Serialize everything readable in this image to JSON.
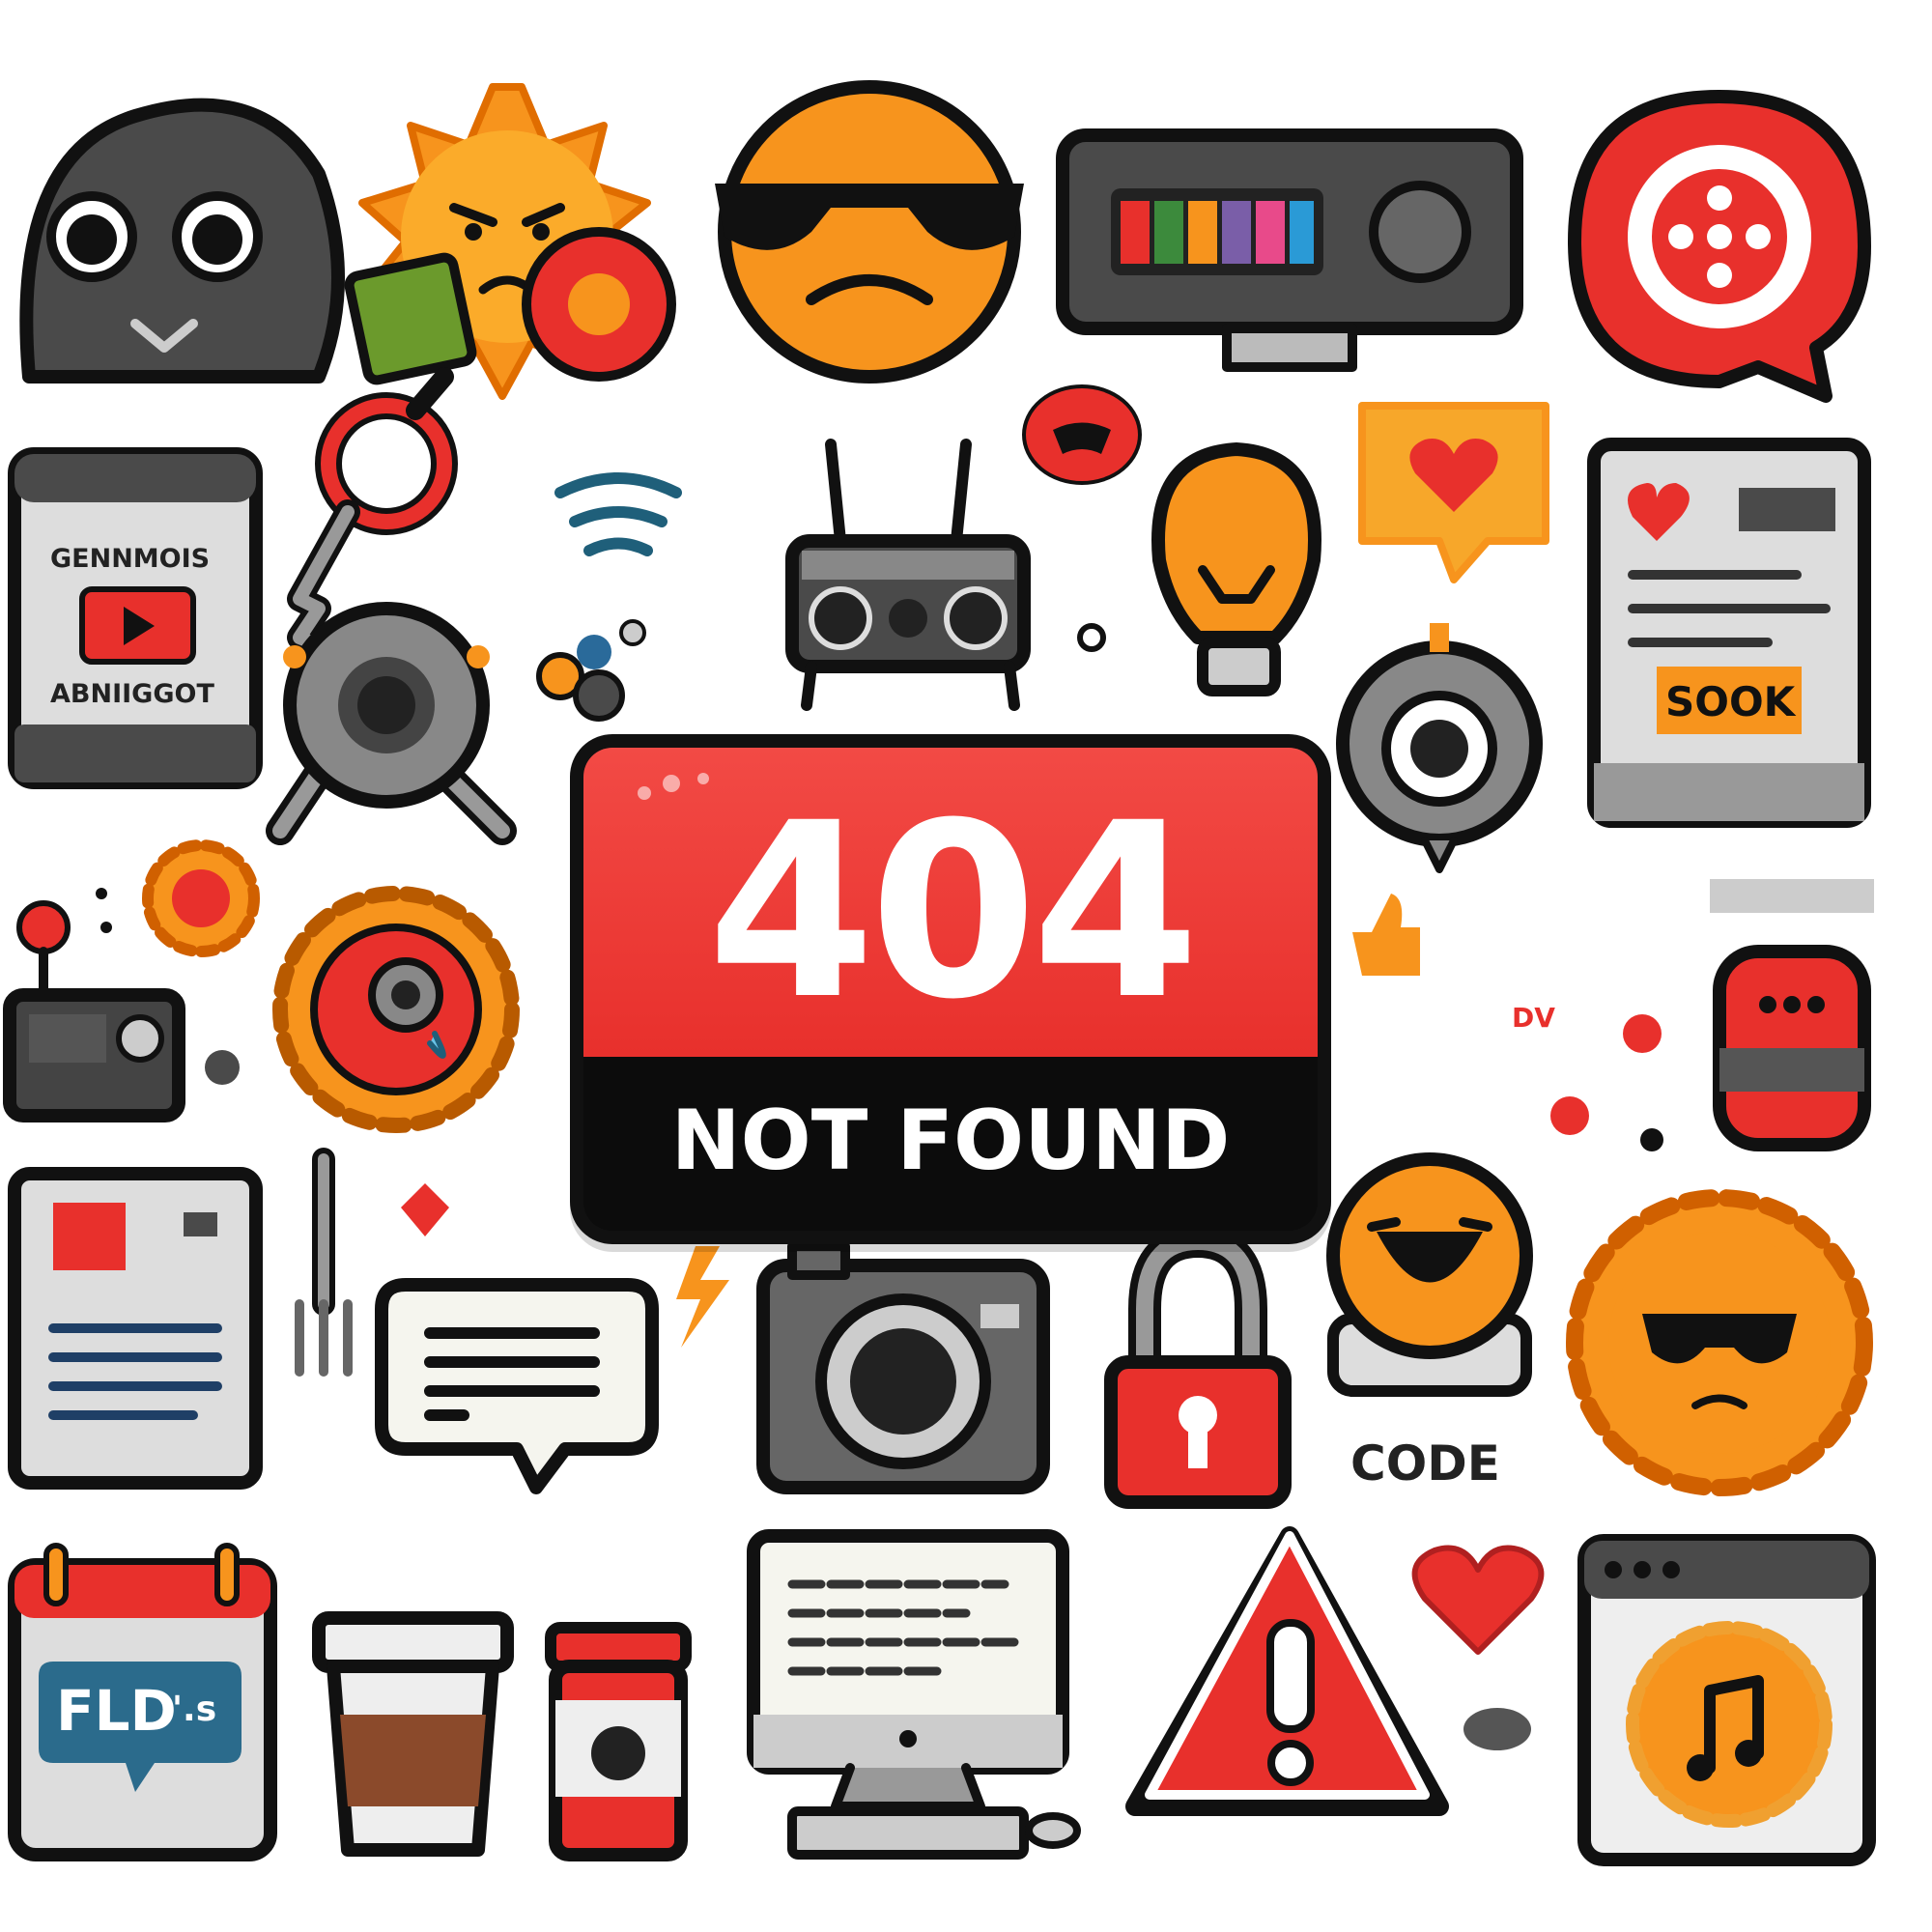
{
  "error_badge": {
    "code": "404",
    "message": "NOT FOUND"
  },
  "labels": {
    "phone_top": "GENNMOIS",
    "phone_bottom": "ABNIIGGOT",
    "book_tag": "SOOK",
    "code_tag": "CODE",
    "dv_tag": "DV",
    "calendar_bubble": "FLD",
    "calendar_bubble_tail": "'.s"
  },
  "colors": {
    "red": "#e8302c",
    "orange": "#f7941d",
    "dark": "#3a3a3a",
    "outline": "#111111"
  },
  "icons": [
    "ghost-face-icon",
    "angry-sun-icon",
    "sunglasses-emoji-icon",
    "retro-tv-icon",
    "chat-bubble-icon",
    "phone-video-icon",
    "key-icon",
    "wifi-icon",
    "router-icon",
    "angry-blob-icon",
    "lightbulb-icon",
    "heart-message-icon",
    "book-icon",
    "robot-gear-icon",
    "joystick-icon",
    "webcam-icon",
    "gear-icon",
    "sad-gear-icon",
    "thumbs-up-icon",
    "fire-extinguisher-icon",
    "document-icon",
    "fork-icon",
    "speech-bubble-icon",
    "camera-icon",
    "padlock-icon",
    "laughing-emoji-icon",
    "cool-sun-icon",
    "calendar-icon",
    "coffee-cup-icon",
    "jar-icon",
    "computer-icon",
    "warning-icon",
    "heart-icon",
    "music-window-icon"
  ]
}
